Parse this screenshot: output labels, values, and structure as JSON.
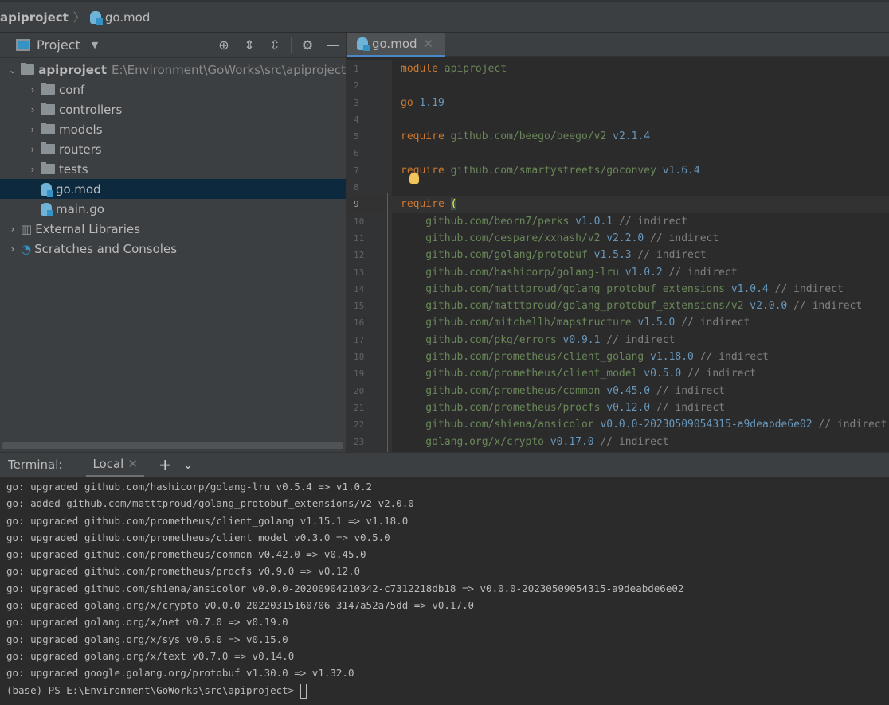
{
  "breadcrumb": {
    "project": "apiproject",
    "file": "go.mod"
  },
  "project_panel": {
    "title": "Project",
    "tree": [
      {
        "label": "apiproject",
        "path": "E:\\Environment\\GoWorks\\src\\apiproject",
        "type": "root",
        "level": 0,
        "expanded": true
      },
      {
        "label": "conf",
        "type": "folder",
        "level": 1
      },
      {
        "label": "controllers",
        "type": "folder",
        "level": 1
      },
      {
        "label": "models",
        "type": "folder",
        "level": 1
      },
      {
        "label": "routers",
        "type": "folder",
        "level": 1
      },
      {
        "label": "tests",
        "type": "folder",
        "level": 1
      },
      {
        "label": "go.mod",
        "type": "gofile",
        "level": 1,
        "selected": true
      },
      {
        "label": "main.go",
        "type": "gofile",
        "level": 1
      },
      {
        "label": "External Libraries",
        "type": "lib",
        "level": 0
      },
      {
        "label": "Scratches and Consoles",
        "type": "scratch",
        "level": 0
      }
    ]
  },
  "editor": {
    "tab": "go.mod",
    "current_line": 9,
    "lines": [
      [
        [
          "module ",
          "k"
        ],
        [
          "apiproject",
          "s"
        ]
      ],
      [],
      [
        [
          "go ",
          "k"
        ],
        [
          "1.19",
          "v"
        ]
      ],
      [],
      [
        [
          "require ",
          "k"
        ],
        [
          "github.com/beego/beego/v2 ",
          "s"
        ],
        [
          "v2.1.4",
          "v"
        ]
      ],
      [],
      [
        [
          "require ",
          "k"
        ],
        [
          "github.com/smartystreets/goconvey ",
          "s"
        ],
        [
          "v1.6.4",
          "v"
        ]
      ],
      [],
      [
        [
          "require ",
          "k"
        ],
        [
          "(",
          "br"
        ]
      ],
      [
        [
          "    github.com/beorn7/perks ",
          "s"
        ],
        [
          "v1.0.1",
          "v"
        ],
        [
          " // indirect",
          "c"
        ]
      ],
      [
        [
          "    github.com/cespare/xxhash/v2 ",
          "s"
        ],
        [
          "v2.2.0",
          "v"
        ],
        [
          " // indirect",
          "c"
        ]
      ],
      [
        [
          "    github.com/golang/protobuf ",
          "s"
        ],
        [
          "v1.5.3",
          "v"
        ],
        [
          " // indirect",
          "c"
        ]
      ],
      [
        [
          "    github.com/hashicorp/golang-lru ",
          "s"
        ],
        [
          "v1.0.2",
          "v"
        ],
        [
          " // indirect",
          "c"
        ]
      ],
      [
        [
          "    github.com/matttproud/golang_protobuf_extensions ",
          "s"
        ],
        [
          "v1.0.4",
          "v"
        ],
        [
          " // indirect",
          "c"
        ]
      ],
      [
        [
          "    github.com/matttproud/golang_protobuf_extensions/v2 ",
          "s"
        ],
        [
          "v2.0.0",
          "v"
        ],
        [
          " // indirect",
          "c"
        ]
      ],
      [
        [
          "    github.com/mitchellh/mapstructure ",
          "s"
        ],
        [
          "v1.5.0",
          "v"
        ],
        [
          " // indirect",
          "c"
        ]
      ],
      [
        [
          "    github.com/pkg/errors ",
          "s"
        ],
        [
          "v0.9.1",
          "v"
        ],
        [
          " // indirect",
          "c"
        ]
      ],
      [
        [
          "    github.com/prometheus/client_golang ",
          "s"
        ],
        [
          "v1.18.0",
          "v"
        ],
        [
          " // indirect",
          "c"
        ]
      ],
      [
        [
          "    github.com/prometheus/client_model ",
          "s"
        ],
        [
          "v0.5.0",
          "v"
        ],
        [
          " // indirect",
          "c"
        ]
      ],
      [
        [
          "    github.com/prometheus/common ",
          "s"
        ],
        [
          "v0.45.0",
          "v"
        ],
        [
          " // indirect",
          "c"
        ]
      ],
      [
        [
          "    github.com/prometheus/procfs ",
          "s"
        ],
        [
          "v0.12.0",
          "v"
        ],
        [
          " // indirect",
          "c"
        ]
      ],
      [
        [
          "    github.com/shiena/ansicolor ",
          "s"
        ],
        [
          "v0.0.0-20230509054315-a9deabde6e02",
          "v"
        ],
        [
          " // indirect",
          "c"
        ]
      ],
      [
        [
          "    golang.org/x/crypto ",
          "s"
        ],
        [
          "v0.17.0",
          "v"
        ],
        [
          " // indirect",
          "c"
        ]
      ]
    ]
  },
  "terminal": {
    "label": "Terminal:",
    "tab": "Local",
    "lines": [
      "go: upgraded github.com/hashicorp/golang-lru v0.5.4 => v1.0.2",
      "go: added github.com/matttproud/golang_protobuf_extensions/v2 v2.0.0",
      "go: upgraded github.com/prometheus/client_golang v1.15.1 => v1.18.0",
      "go: upgraded github.com/prometheus/client_model v0.3.0 => v0.5.0",
      "go: upgraded github.com/prometheus/common v0.42.0 => v0.45.0",
      "go: upgraded github.com/prometheus/procfs v0.9.0 => v0.12.0",
      "go: upgraded github.com/shiena/ansicolor v0.0.0-20200904210342-c7312218db18 => v0.0.0-20230509054315-a9deabde6e02",
      "go: upgraded golang.org/x/crypto v0.0.0-20220315160706-3147a52a75dd => v0.17.0",
      "go: upgraded golang.org/x/net v0.7.0 => v0.19.0",
      "go: upgraded golang.org/x/sys v0.6.0 => v0.15.0",
      "go: upgraded golang.org/x/text v0.7.0 => v0.14.0",
      "go: upgraded google.golang.org/protobuf v1.30.0 => v1.32.0"
    ],
    "prompt": "(base) PS E:\\Environment\\GoWorks\\src\\apiproject> "
  }
}
